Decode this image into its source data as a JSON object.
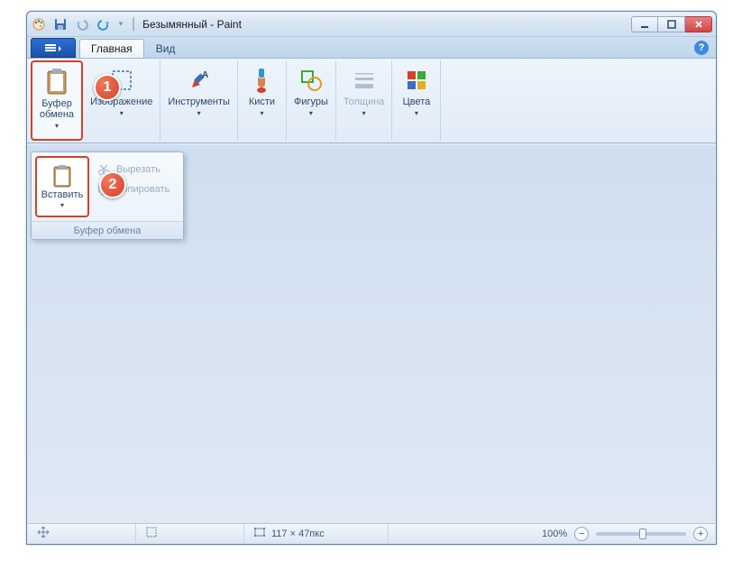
{
  "window": {
    "title_doc": "Безымянный",
    "title_app": "Paint"
  },
  "tabs": {
    "home": "Главная",
    "view": "Вид"
  },
  "ribbon": {
    "clipboard": "Буфер\nобмена",
    "image": "Изображение",
    "tools": "Инструменты",
    "brushes": "Кисти",
    "shapes": "Фигуры",
    "thickness": "Толщина",
    "colors": "Цвета"
  },
  "dropdown": {
    "paste": "Вставить",
    "cut": "Вырезать",
    "copy": "Копировать",
    "footer": "Буфер обмена"
  },
  "status": {
    "dimensions": "117 × 47пкс",
    "zoom": "100%"
  },
  "callouts": {
    "one": "1",
    "two": "2"
  }
}
